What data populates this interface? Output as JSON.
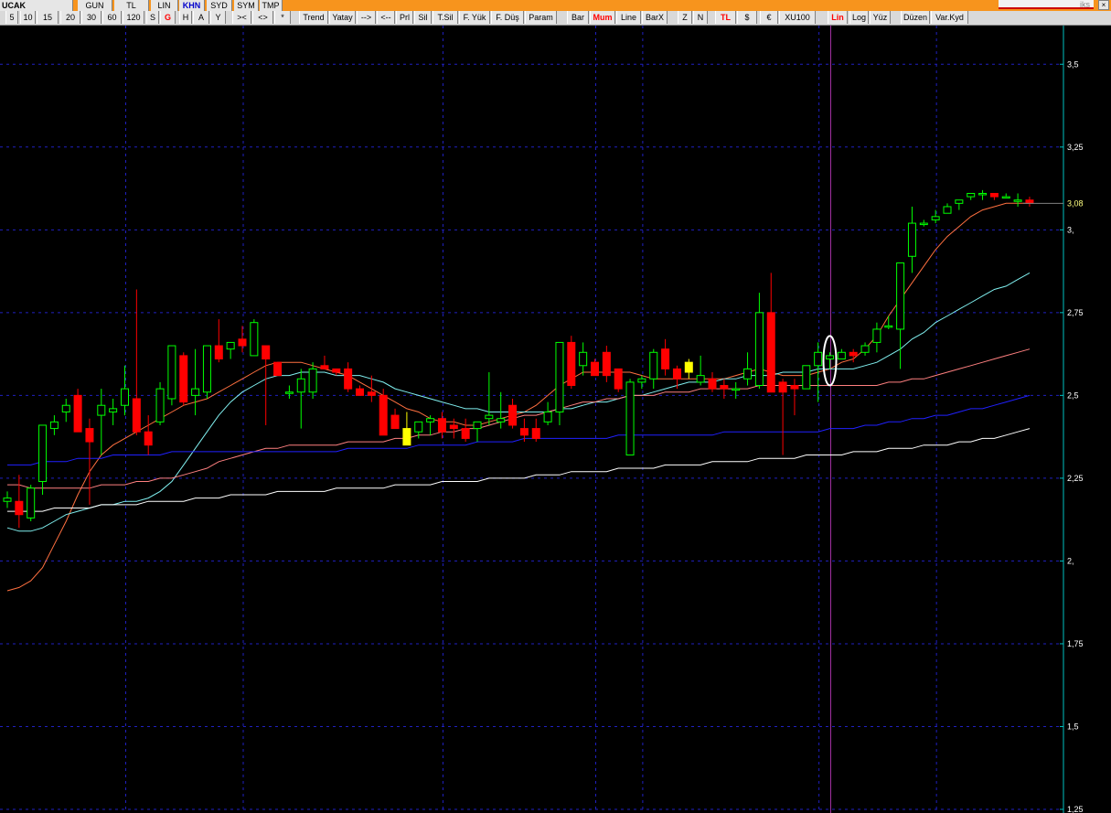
{
  "top_row": {
    "items": [
      "UCAK",
      "GUN",
      "TL",
      "LIN",
      "KHN",
      "SYD",
      "SYM",
      "TMP"
    ]
  },
  "toolbar": {
    "buttons": [
      "5",
      "10",
      "15",
      "20",
      "30",
      "60",
      "120",
      "S",
      "G",
      "H",
      "A",
      "Y",
      "><",
      "<>",
      "*",
      "Trend",
      "Yatay",
      "-->",
      "<--",
      "Prl",
      "Sil",
      "T.Sil",
      "F. Yük",
      "F. Düş",
      "Param",
      "Bar",
      "Mum",
      "Line",
      "BarX",
      "Z",
      "N",
      "TL",
      "$",
      "€",
      "XU100",
      "Lin",
      "Log",
      "Yüz",
      "Düzen",
      "Var.Kyd"
    ]
  },
  "logo_text": "iks",
  "close_label": "×",
  "colors": {
    "up": "#00ff00",
    "down": "#ff0000",
    "doji": "#ffff00",
    "grid": "#2020c0",
    "axis": "#00c0c0",
    "vline": "#a030a0",
    "ma_orange": "#ff7040",
    "ma_cyan": "#80f0f0",
    "ma_pink": "#ff8080",
    "ma_blue": "#2020ff",
    "ma_white": "#ffffff"
  },
  "chart_data": {
    "type": "candlestick",
    "y_axis": {
      "min": 1.25,
      "max": 3.625,
      "ticks": [
        "1,25",
        "1,5",
        "1,75",
        "2,",
        "2,25",
        "2,5",
        "2,75",
        "3,",
        "3,25",
        "3,5"
      ],
      "tick_values": [
        1.25,
        1.5,
        1.75,
        2.0,
        2.25,
        2.5,
        2.75,
        3.0,
        3.25,
        3.5
      ]
    },
    "last_price_label": "3,08",
    "last_price": 3.08,
    "grid": true,
    "candles": [
      [
        2.18,
        2.21,
        2.16,
        2.19
      ],
      [
        2.18,
        2.26,
        2.1,
        2.14
      ],
      [
        2.13,
        2.23,
        2.12,
        2.22
      ],
      [
        2.24,
        2.4,
        2.2,
        2.41
      ],
      [
        2.4,
        2.44,
        2.38,
        2.42
      ],
      [
        2.45,
        2.49,
        2.42,
        2.47
      ],
      [
        2.5,
        2.52,
        2.4,
        2.39
      ],
      [
        2.4,
        2.43,
        2.17,
        2.36
      ],
      [
        2.44,
        2.52,
        2.32,
        2.47
      ],
      [
        2.45,
        2.49,
        2.41,
        2.46
      ],
      [
        2.47,
        2.59,
        2.44,
        2.52
      ],
      [
        2.49,
        2.82,
        2.38,
        2.39
      ],
      [
        2.39,
        2.44,
        2.32,
        2.35
      ],
      [
        2.42,
        2.54,
        2.41,
        2.52
      ],
      [
        2.49,
        2.64,
        2.47,
        2.65
      ],
      [
        2.62,
        2.63,
        2.47,
        2.48
      ],
      [
        2.5,
        2.64,
        2.44,
        2.52
      ],
      [
        2.51,
        2.64,
        2.49,
        2.65
      ],
      [
        2.65,
        2.73,
        2.6,
        2.61
      ],
      [
        2.64,
        2.66,
        2.61,
        2.66
      ],
      [
        2.67,
        2.71,
        2.63,
        2.65
      ],
      [
        2.62,
        2.73,
        2.63,
        2.72
      ],
      [
        2.65,
        2.65,
        2.41,
        2.61
      ],
      [
        2.6,
        2.6,
        2.57,
        2.56
      ],
      [
        2.51,
        2.53,
        2.49,
        2.51
      ],
      [
        2.51,
        2.58,
        2.4,
        2.55
      ],
      [
        2.51,
        2.6,
        2.49,
        2.58
      ],
      [
        2.59,
        2.62,
        2.58,
        2.58
      ],
      [
        2.58,
        2.58,
        2.56,
        2.57
      ],
      [
        2.58,
        2.6,
        2.51,
        2.52
      ],
      [
        2.52,
        2.53,
        2.5,
        2.5
      ],
      [
        2.51,
        2.56,
        2.48,
        2.5
      ],
      [
        2.5,
        2.52,
        2.39,
        2.38
      ],
      [
        2.44,
        2.46,
        2.42,
        2.4
      ],
      [
        2.4,
        2.45,
        2.35,
        2.35
      ],
      [
        2.39,
        2.42,
        2.37,
        2.42
      ],
      [
        2.42,
        2.44,
        2.38,
        2.43
      ],
      [
        2.43,
        2.45,
        2.37,
        2.39
      ],
      [
        2.41,
        2.43,
        2.37,
        2.4
      ],
      [
        2.4,
        2.43,
        2.36,
        2.37
      ],
      [
        2.4,
        2.42,
        2.36,
        2.42
      ],
      [
        2.43,
        2.57,
        2.41,
        2.44
      ],
      [
        2.42,
        2.51,
        2.4,
        2.43
      ],
      [
        2.47,
        2.49,
        2.4,
        2.41
      ],
      [
        2.4,
        2.43,
        2.36,
        2.38
      ],
      [
        2.4,
        2.43,
        2.36,
        2.37
      ],
      [
        2.42,
        2.48,
        2.41,
        2.45
      ],
      [
        2.45,
        2.59,
        2.41,
        2.66
      ],
      [
        2.66,
        2.68,
        2.52,
        2.53
      ],
      [
        2.59,
        2.66,
        2.56,
        2.63
      ],
      [
        2.6,
        2.61,
        2.56,
        2.56
      ],
      [
        2.63,
        2.65,
        2.54,
        2.56
      ],
      [
        2.58,
        2.58,
        2.51,
        2.52
      ],
      [
        2.32,
        2.55,
        2.32,
        2.54
      ],
      [
        2.54,
        2.56,
        2.52,
        2.55
      ],
      [
        2.55,
        2.64,
        2.52,
        2.63
      ],
      [
        2.64,
        2.67,
        2.56,
        2.58
      ],
      [
        2.58,
        2.59,
        2.52,
        2.55
      ],
      [
        2.6,
        2.61,
        2.55,
        2.57
      ],
      [
        2.54,
        2.62,
        2.53,
        2.56
      ],
      [
        2.55,
        2.57,
        2.51,
        2.52
      ],
      [
        2.53,
        2.55,
        2.49,
        2.52
      ],
      [
        2.52,
        2.54,
        2.49,
        2.52
      ],
      [
        2.55,
        2.63,
        2.53,
        2.58
      ],
      [
        2.53,
        2.81,
        2.52,
        2.75
      ],
      [
        2.75,
        2.87,
        2.51,
        2.51
      ],
      [
        2.54,
        2.55,
        2.32,
        2.51
      ],
      [
        2.53,
        2.55,
        2.44,
        2.52
      ],
      [
        2.52,
        2.58,
        2.53,
        2.59
      ],
      [
        2.59,
        2.66,
        2.48,
        2.63
      ],
      [
        2.61,
        2.63,
        2.58,
        2.62
      ],
      [
        2.61,
        2.64,
        2.61,
        2.63
      ],
      [
        2.63,
        2.64,
        2.6,
        2.62
      ],
      [
        2.63,
        2.66,
        2.62,
        2.65
      ],
      [
        2.66,
        2.72,
        2.63,
        2.7
      ],
      [
        2.71,
        2.74,
        2.7,
        2.71
      ],
      [
        2.7,
        2.74,
        2.58,
        2.9
      ],
      [
        2.92,
        3.07,
        2.87,
        3.02
      ],
      [
        3.02,
        3.03,
        3.01,
        3.02
      ],
      [
        3.03,
        3.06,
        3.02,
        3.04
      ],
      [
        3.05,
        3.08,
        3.05,
        3.07
      ],
      [
        3.08,
        3.09,
        3.06,
        3.09
      ],
      [
        3.1,
        3.11,
        3.09,
        3.11
      ],
      [
        3.11,
        3.12,
        3.09,
        3.11
      ],
      [
        3.11,
        3.11,
        3.09,
        3.1
      ],
      [
        3.1,
        3.11,
        3.1,
        3.1
      ],
      [
        3.09,
        3.11,
        3.07,
        3.09
      ],
      [
        3.09,
        3.1,
        3.07,
        3.08
      ]
    ],
    "special_candles": {
      "doji_yellow": [
        58,
        34
      ]
    },
    "moving_averages": [
      {
        "color": "ma_orange",
        "values": [
          1.91,
          1.92,
          1.94,
          1.98,
          2.05,
          2.12,
          2.2,
          2.27,
          2.32,
          2.35,
          2.37,
          2.39,
          2.41,
          2.43,
          2.45,
          2.47,
          2.48,
          2.49,
          2.51,
          2.53,
          2.55,
          2.57,
          2.59,
          2.6,
          2.6,
          2.6,
          2.59,
          2.58,
          2.57,
          2.56,
          2.54,
          2.52,
          2.5,
          2.48,
          2.46,
          2.45,
          2.43,
          2.42,
          2.42,
          2.41,
          2.41,
          2.42,
          2.43,
          2.44,
          2.45,
          2.47,
          2.5,
          2.53,
          2.55,
          2.57,
          2.57,
          2.57,
          2.57,
          2.57,
          2.56,
          2.55,
          2.55,
          2.55,
          2.55,
          2.55,
          2.55,
          2.55,
          2.56,
          2.57,
          2.58,
          2.57,
          2.56,
          2.56,
          2.56,
          2.57,
          2.58,
          2.6,
          2.61,
          2.64,
          2.68,
          2.74,
          2.79,
          2.84,
          2.89,
          2.94,
          2.98,
          3.01,
          3.04,
          3.06,
          3.07,
          3.08,
          3.08,
          3.08
        ]
      },
      {
        "color": "ma_cyan",
        "values": [
          2.1,
          2.09,
          2.09,
          2.1,
          2.12,
          2.14,
          2.15,
          2.16,
          2.17,
          2.17,
          2.18,
          2.18,
          2.19,
          2.21,
          2.24,
          2.29,
          2.34,
          2.39,
          2.44,
          2.48,
          2.51,
          2.53,
          2.55,
          2.56,
          2.56,
          2.57,
          2.57,
          2.57,
          2.56,
          2.56,
          2.56,
          2.55,
          2.54,
          2.52,
          2.51,
          2.5,
          2.49,
          2.48,
          2.47,
          2.46,
          2.46,
          2.45,
          2.45,
          2.45,
          2.45,
          2.45,
          2.45,
          2.46,
          2.46,
          2.47,
          2.48,
          2.48,
          2.49,
          2.5,
          2.5,
          2.51,
          2.52,
          2.53,
          2.54,
          2.54,
          2.54,
          2.55,
          2.55,
          2.56,
          2.56,
          2.56,
          2.57,
          2.57,
          2.57,
          2.58,
          2.58,
          2.58,
          2.58,
          2.59,
          2.6,
          2.62,
          2.64,
          2.67,
          2.69,
          2.72,
          2.74,
          2.76,
          2.78,
          2.8,
          2.82,
          2.83,
          2.85,
          2.87
        ]
      },
      {
        "color": "ma_pink",
        "values": [
          2.23,
          2.23,
          2.22,
          2.22,
          2.22,
          2.22,
          2.22,
          2.22,
          2.23,
          2.23,
          2.23,
          2.24,
          2.24,
          2.25,
          2.25,
          2.26,
          2.27,
          2.28,
          2.3,
          2.31,
          2.32,
          2.33,
          2.34,
          2.34,
          2.35,
          2.35,
          2.35,
          2.35,
          2.35,
          2.36,
          2.36,
          2.36,
          2.36,
          2.37,
          2.37,
          2.38,
          2.38,
          2.39,
          2.39,
          2.4,
          2.4,
          2.41,
          2.42,
          2.43,
          2.44,
          2.44,
          2.45,
          2.46,
          2.47,
          2.48,
          2.48,
          2.49,
          2.49,
          2.5,
          2.5,
          2.5,
          2.51,
          2.51,
          2.51,
          2.52,
          2.52,
          2.52,
          2.52,
          2.52,
          2.53,
          2.53,
          2.53,
          2.53,
          2.53,
          2.53,
          2.53,
          2.53,
          2.53,
          2.53,
          2.53,
          2.54,
          2.54,
          2.55,
          2.55,
          2.56,
          2.57,
          2.58,
          2.59,
          2.6,
          2.61,
          2.62,
          2.63,
          2.64
        ]
      },
      {
        "color": "ma_blue",
        "values": [
          2.29,
          2.29,
          2.29,
          2.3,
          2.3,
          2.3,
          2.31,
          2.31,
          2.31,
          2.32,
          2.32,
          2.32,
          2.32,
          2.32,
          2.33,
          2.33,
          2.33,
          2.33,
          2.33,
          2.33,
          2.33,
          2.33,
          2.33,
          2.33,
          2.33,
          2.33,
          2.33,
          2.33,
          2.33,
          2.34,
          2.34,
          2.34,
          2.34,
          2.34,
          2.34,
          2.35,
          2.35,
          2.35,
          2.35,
          2.35,
          2.36,
          2.36,
          2.36,
          2.36,
          2.37,
          2.37,
          2.37,
          2.37,
          2.37,
          2.37,
          2.37,
          2.37,
          2.38,
          2.38,
          2.38,
          2.38,
          2.38,
          2.38,
          2.38,
          2.38,
          2.38,
          2.39,
          2.39,
          2.39,
          2.39,
          2.39,
          2.39,
          2.39,
          2.39,
          2.39,
          2.4,
          2.4,
          2.4,
          2.41,
          2.41,
          2.42,
          2.42,
          2.43,
          2.43,
          2.44,
          2.44,
          2.45,
          2.46,
          2.46,
          2.47,
          2.48,
          2.49,
          2.5
        ]
      },
      {
        "color": "ma_white",
        "values": [
          2.15,
          2.15,
          2.15,
          2.15,
          2.16,
          2.16,
          2.16,
          2.16,
          2.17,
          2.17,
          2.17,
          2.17,
          2.18,
          2.18,
          2.18,
          2.18,
          2.19,
          2.19,
          2.19,
          2.2,
          2.2,
          2.2,
          2.2,
          2.21,
          2.21,
          2.21,
          2.21,
          2.21,
          2.22,
          2.22,
          2.22,
          2.22,
          2.22,
          2.23,
          2.23,
          2.23,
          2.23,
          2.24,
          2.24,
          2.24,
          2.24,
          2.25,
          2.25,
          2.25,
          2.25,
          2.26,
          2.26,
          2.26,
          2.27,
          2.27,
          2.27,
          2.27,
          2.28,
          2.28,
          2.28,
          2.28,
          2.29,
          2.29,
          2.29,
          2.29,
          2.3,
          2.3,
          2.3,
          2.3,
          2.31,
          2.31,
          2.31,
          2.31,
          2.32,
          2.32,
          2.32,
          2.32,
          2.33,
          2.33,
          2.33,
          2.34,
          2.34,
          2.34,
          2.35,
          2.35,
          2.35,
          2.36,
          2.36,
          2.37,
          2.37,
          2.38,
          2.39,
          2.4
        ]
      }
    ],
    "highlighted_candle_index": 70,
    "vertical_marker_index": 70
  }
}
